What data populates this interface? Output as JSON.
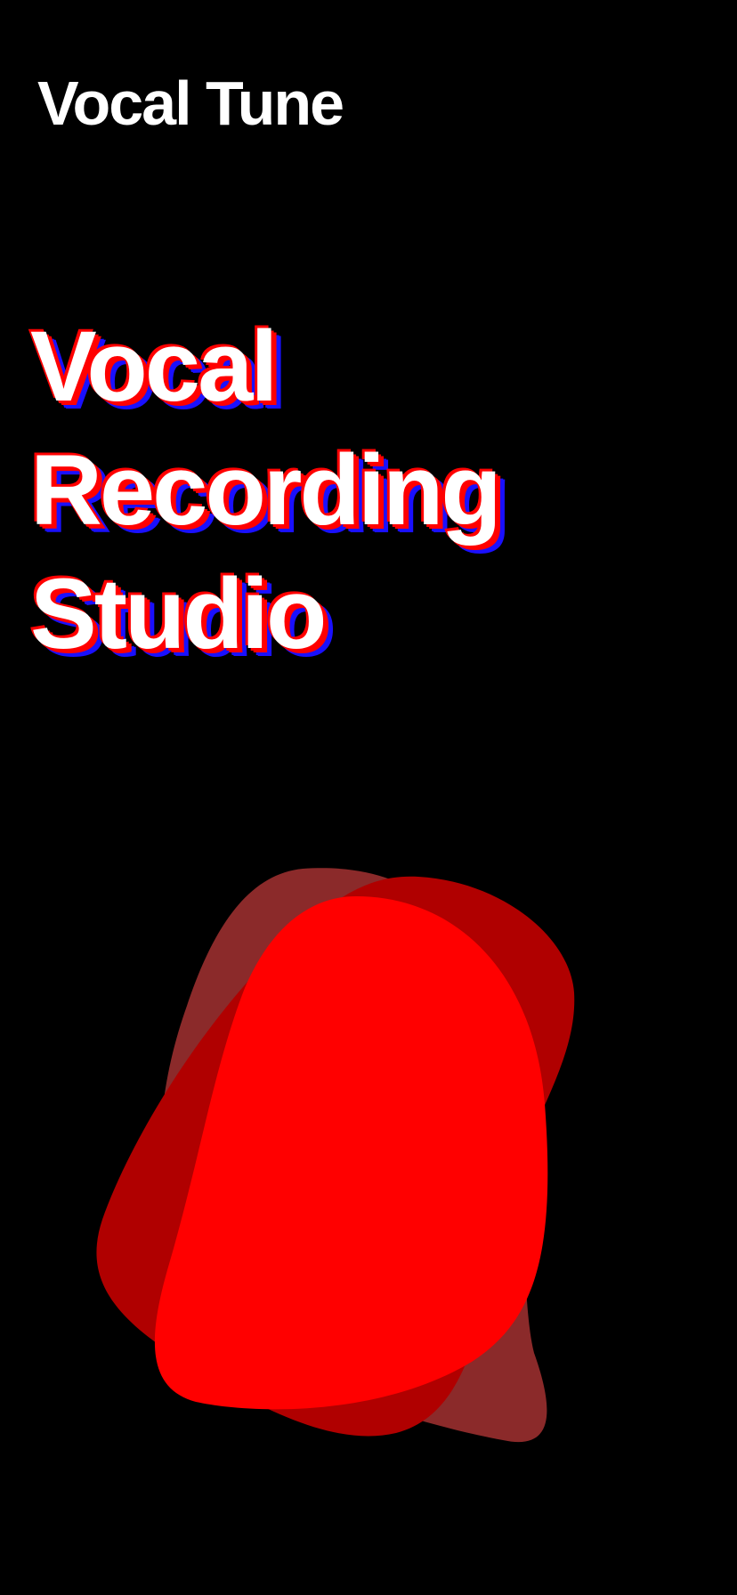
{
  "app": {
    "title": "Vocal Tune"
  },
  "hero": {
    "headline_lines": [
      "Vocal",
      "Recording",
      "Studio"
    ]
  },
  "illustration": {
    "name": "red-blob-illustration",
    "colors": {
      "back_blob": "#8b2a2a",
      "middle_blob": "#b00000",
      "front_blob": "#ff0000",
      "headline_shadow_primary": "#ff0000",
      "headline_shadow_secondary": "#1a10ff",
      "background": "#000000"
    }
  }
}
